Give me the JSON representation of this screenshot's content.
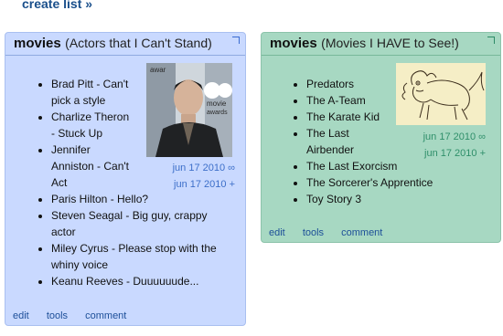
{
  "header": {
    "create_list": "create list »"
  },
  "lists": [
    {
      "title": "movies",
      "subtitle": "(Actors that I Can't Stand)",
      "items": [
        "Brad Pitt - Can't pick a style",
        "Charlize Theron - Stuck Up",
        "Jennifer Anniston - Can't Act",
        "Paris Hilton - Hello?",
        "Steven Seagal - Big guy, crappy actor",
        "Miley Cyrus - Please stop with the whiny voice",
        "Keanu Reeves - Duuuuuude..."
      ],
      "date_line1": "jun 17 2010 ∞",
      "date_line2": "jun 17 2010 +",
      "footer": [
        "edit",
        "tools",
        "comment"
      ],
      "bg_color": "#c9d9ff"
    },
    {
      "title": "movies",
      "subtitle": "(Movies I HAVE to See!)",
      "items": [
        "Predators",
        "The A-Team",
        "The Karate Kid",
        "The Last Airbender",
        "The Last Exorcism",
        "The Sorcerer's Apprentice",
        "Toy Story 3"
      ],
      "date_line1": "jun 17 2010 ∞",
      "date_line2": "jun 17 2010 +",
      "footer": [
        "edit",
        "tools",
        "comment"
      ],
      "bg_color": "#a7d8c2"
    }
  ],
  "icons": {
    "corner": "corner-expand-icon",
    "photo": "person-photo",
    "sketch": "creature-sketch"
  }
}
